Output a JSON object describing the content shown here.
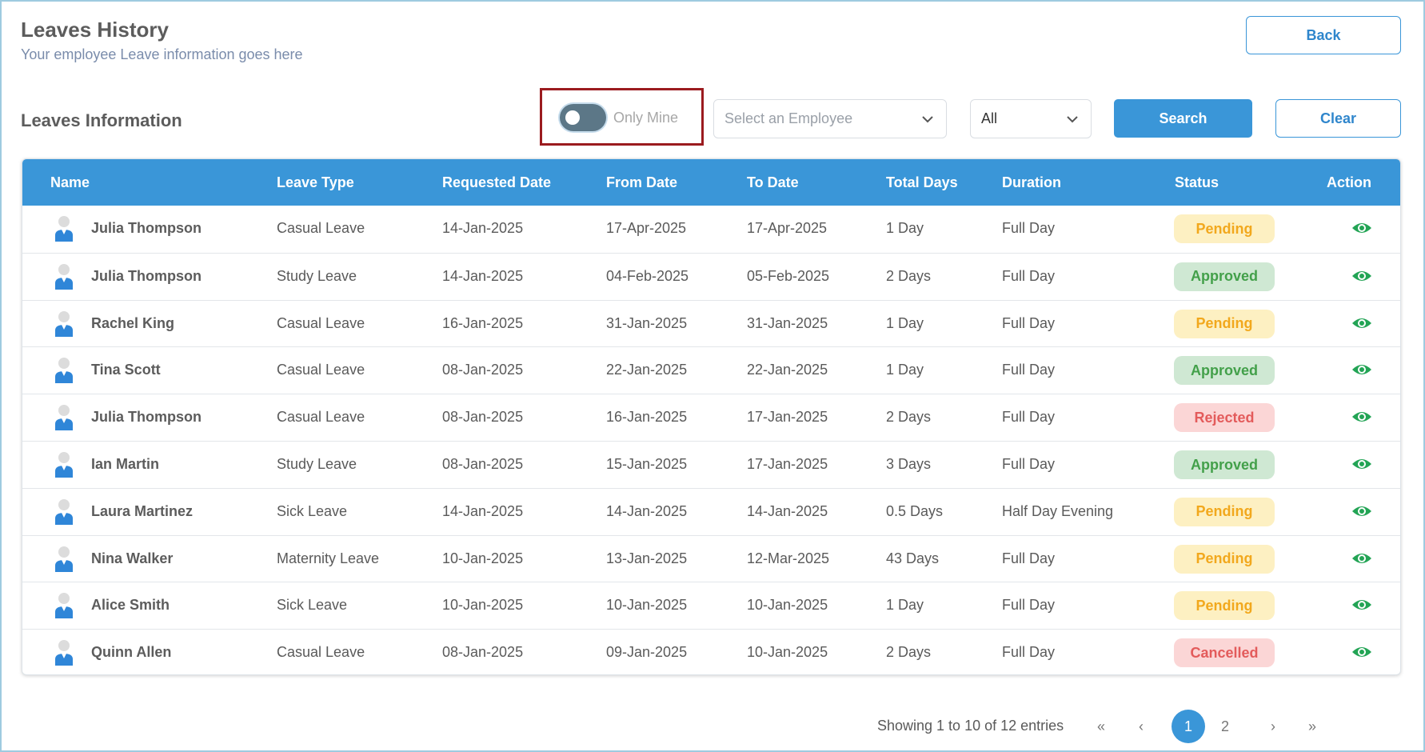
{
  "header": {
    "title": "Leaves History",
    "subtitle": "Your employee Leave information goes here",
    "back_label": "Back"
  },
  "filters": {
    "section_title": "Leaves Information",
    "only_mine_label": "Only Mine",
    "only_mine_on": false,
    "employee_placeholder": "Select an Employee",
    "status_value": "All",
    "search_label": "Search",
    "clear_label": "Clear"
  },
  "table": {
    "columns": [
      "Name",
      "Leave Type",
      "Requested Date",
      "From Date",
      "To Date",
      "Total Days",
      "Duration",
      "Status",
      "Action"
    ],
    "rows": [
      {
        "name": "Julia Thompson",
        "leave_type": "Casual Leave",
        "requested": "14-Jan-2025",
        "from": "17-Apr-2025",
        "to": "17-Apr-2025",
        "total": "1 Day",
        "duration": "Full Day",
        "status": "Pending"
      },
      {
        "name": "Julia Thompson",
        "leave_type": "Study Leave",
        "requested": "14-Jan-2025",
        "from": "04-Feb-2025",
        "to": "05-Feb-2025",
        "total": "2 Days",
        "duration": "Full Day",
        "status": "Approved"
      },
      {
        "name": "Rachel King",
        "leave_type": "Casual Leave",
        "requested": "16-Jan-2025",
        "from": "31-Jan-2025",
        "to": "31-Jan-2025",
        "total": "1 Day",
        "duration": "Full Day",
        "status": "Pending"
      },
      {
        "name": "Tina Scott",
        "leave_type": "Casual Leave",
        "requested": "08-Jan-2025",
        "from": "22-Jan-2025",
        "to": "22-Jan-2025",
        "total": "1 Day",
        "duration": "Full Day",
        "status": "Approved"
      },
      {
        "name": "Julia Thompson",
        "leave_type": "Casual Leave",
        "requested": "08-Jan-2025",
        "from": "16-Jan-2025",
        "to": "17-Jan-2025",
        "total": "2 Days",
        "duration": "Full Day",
        "status": "Rejected"
      },
      {
        "name": "Ian Martin",
        "leave_type": "Study Leave",
        "requested": "08-Jan-2025",
        "from": "15-Jan-2025",
        "to": "17-Jan-2025",
        "total": "3 Days",
        "duration": "Full Day",
        "status": "Approved"
      },
      {
        "name": "Laura Martinez",
        "leave_type": "Sick Leave",
        "requested": "14-Jan-2025",
        "from": "14-Jan-2025",
        "to": "14-Jan-2025",
        "total": "0.5 Days",
        "duration": "Half Day Evening",
        "status": "Pending"
      },
      {
        "name": "Nina Walker",
        "leave_type": "Maternity Leave",
        "requested": "10-Jan-2025",
        "from": "13-Jan-2025",
        "to": "12-Mar-2025",
        "total": "43 Days",
        "duration": "Full Day",
        "status": "Pending"
      },
      {
        "name": "Alice Smith",
        "leave_type": "Sick Leave",
        "requested": "10-Jan-2025",
        "from": "10-Jan-2025",
        "to": "10-Jan-2025",
        "total": "1 Day",
        "duration": "Full Day",
        "status": "Pending"
      },
      {
        "name": "Quinn Allen",
        "leave_type": "Casual Leave",
        "requested": "08-Jan-2025",
        "from": "09-Jan-2025",
        "to": "10-Jan-2025",
        "total": "2 Days",
        "duration": "Full Day",
        "status": "Cancelled"
      }
    ]
  },
  "status_colors": {
    "Pending": {
      "bg": "#fdf0c2",
      "fg": "#f2a81d"
    },
    "Approved": {
      "bg": "#cfe8d3",
      "fg": "#43a04a"
    },
    "Rejected": {
      "bg": "#fbd6d6",
      "fg": "#e35b5b"
    },
    "Cancelled": {
      "bg": "#fbd6d6",
      "fg": "#e35b5b"
    }
  },
  "icons": {
    "row_avatar": "user-avatar-icon",
    "row_action": "eye-icon"
  },
  "colors": {
    "accent": "#3a96d8",
    "action_icon": "#23a455",
    "highlight_box": "#9b1b1f"
  },
  "pagination": {
    "info": "Showing 1 to 10 of 12 entries",
    "first": "«",
    "prev": "‹",
    "pages": [
      "1",
      "2"
    ],
    "current_page": "1",
    "next": "›",
    "last": "»"
  }
}
